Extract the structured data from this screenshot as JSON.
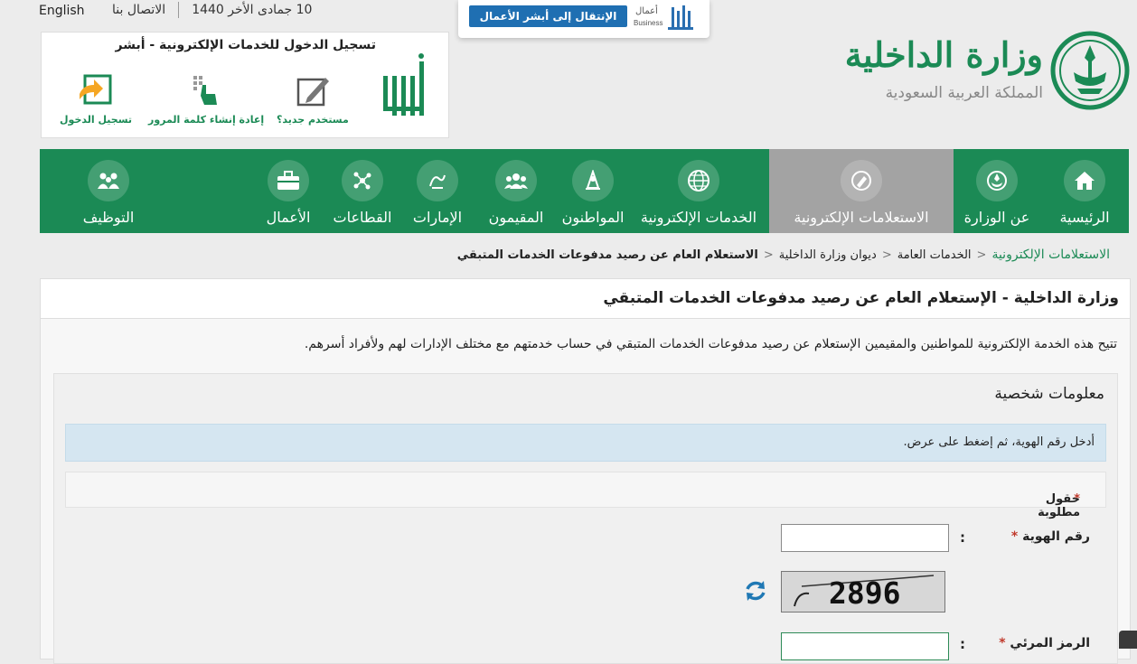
{
  "topbar": {
    "english": "English",
    "contact": "الاتصال بنا",
    "date": "10 جمادى الأخر 1440"
  },
  "business": {
    "button": "الإنتقال إلى أبشر الأعمال",
    "logo_text": "أعمال",
    "logo_en": "Business"
  },
  "login": {
    "title": "تسجيل الدخول للخدمات الإلكترونية - أبشر",
    "actions": [
      {
        "label": "مستخدم جديد؟",
        "icon": "edit-icon"
      },
      {
        "label": "إعادة إنشاء كلمة المرور",
        "icon": "keypad-icon"
      },
      {
        "label": "تسجيل الدخول",
        "icon": "login-icon"
      }
    ]
  },
  "header": {
    "ministry": "وزارة الداخلية",
    "kingdom": "المملكة العربية السعودية"
  },
  "nav": {
    "items": [
      {
        "label": "الرئيسية",
        "icon": "home-icon"
      },
      {
        "label": "عن الوزارة",
        "icon": "emblem-icon"
      },
      {
        "label": "الاستعلامات الإلكترونية",
        "icon": "inquiry-icon"
      },
      {
        "label": "الخدمات الإلكترونية",
        "icon": "globe-icon"
      },
      {
        "label": "المواطنون",
        "icon": "citizen-icon"
      },
      {
        "label": "المقيمون",
        "icon": "residents-icon"
      },
      {
        "label": "الإمارات",
        "icon": "emirates-icon"
      },
      {
        "label": "القطاعات",
        "icon": "sectors-icon"
      },
      {
        "label": "الأعمال",
        "icon": "briefcase-icon"
      },
      {
        "label": "التوظيف",
        "icon": "employment-icon"
      }
    ]
  },
  "breadcrumb": {
    "items": [
      "الاستعلامات الإلكترونية",
      "الخدمات العامة",
      "ديوان وزارة الداخلية"
    ],
    "current": "الاستعلام العام عن رصيد مدفوعات الخدمات المتبقي"
  },
  "page": {
    "title": "وزارة الداخلية - الإستعلام العام عن رصيد مدفوعات الخدمات المتبقي",
    "description": "تتيح هذه الخدمة الإلكترونية للمواطنين والمقيمين الإستعلام عن رصيد مدفوعات الخدمات المتبقي في حساب خدمتهم مع مختلف الإدارات لهم ولأفراد أسرهم."
  },
  "form": {
    "section_title": "معلومات شخصية",
    "info": "أدخل رقم الهوية، ثم إضغط على عرض.",
    "required_note": "حقول مطلوبة",
    "id_label": "رقم الهوية",
    "id_value": "",
    "captcha_code": "2896",
    "captcha_label": "الرمز المرئي",
    "colon": ":",
    "star": "*"
  },
  "colors": {
    "primary": "#1b8a55",
    "active_nav": "#a3a3a3",
    "info": "#d5e6f1"
  }
}
